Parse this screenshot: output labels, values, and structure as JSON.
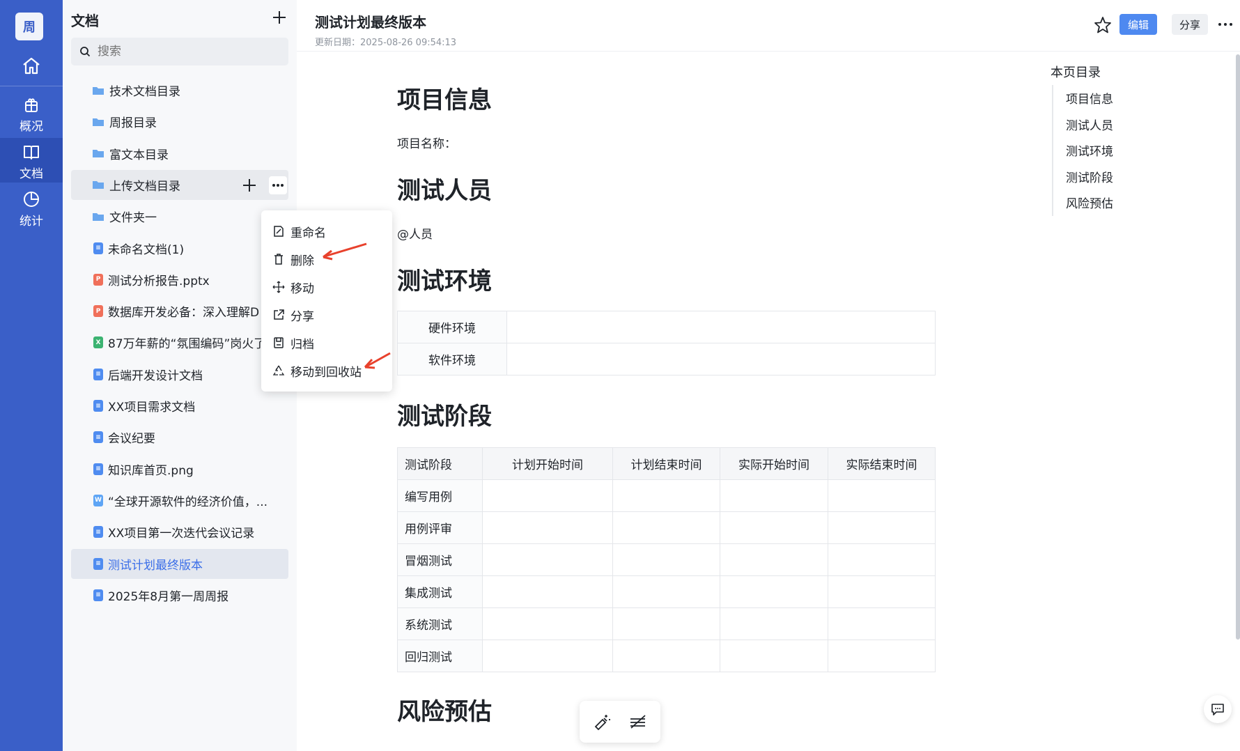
{
  "rail": {
    "avatar": "周",
    "items": [
      {
        "label": ""
      },
      {
        "label": "概况"
      },
      {
        "label": "文档"
      },
      {
        "label": "统计"
      }
    ]
  },
  "sidebar": {
    "title": "文档",
    "search_placeholder": "搜索",
    "items": [
      {
        "label": "技术文档目录",
        "type": "folder"
      },
      {
        "label": "周报目录",
        "type": "folder"
      },
      {
        "label": "富文本目录",
        "type": "folder"
      },
      {
        "label": "上传文档目录",
        "type": "folder"
      },
      {
        "label": "文件夹一",
        "type": "folder"
      },
      {
        "label": "未命名文档(1)",
        "type": "doc"
      },
      {
        "label": "测试分析报告.pptx",
        "type": "ppt"
      },
      {
        "label": "数据库开发必备：深入理解D",
        "type": "ppt"
      },
      {
        "label": "87万年薪的“氛围编码”岗火了",
        "type": "xls"
      },
      {
        "label": "后端开发设计文档",
        "type": "doc"
      },
      {
        "label": "XX项目需求文档",
        "type": "doc"
      },
      {
        "label": "会议纪要",
        "type": "doc"
      },
      {
        "label": "知识库首页.png",
        "type": "doc"
      },
      {
        "label": "“全球开源软件的经济价值，...",
        "type": "word"
      },
      {
        "label": "XX项目第一次迭代会议记录",
        "type": "doc"
      },
      {
        "label": "测试计划最终版本",
        "type": "doc"
      },
      {
        "label": "2025年8月第一周周报",
        "type": "doc"
      }
    ]
  },
  "context_menu": {
    "items": [
      "重命名",
      "删除",
      "移动",
      "分享",
      "归档",
      "移动到回收站"
    ]
  },
  "header": {
    "title": "测试计划最终版本",
    "date": "更新日期：2025-08-26 09:54:13",
    "edit_label": "编辑",
    "share_label": "分享"
  },
  "doc": {
    "h_project": "项目信息",
    "project_name": "项目名称：",
    "h_people": "测试人员",
    "people_mention": "@人员",
    "h_env": "测试环境",
    "env_rows": [
      "硬件环境",
      "软件环境"
    ],
    "h_stage": "测试阶段",
    "stage_headers": [
      "测试阶段",
      "计划开始时间",
      "计划结束时间",
      "实际开始时间",
      "实际结束时间"
    ],
    "stage_rows": [
      "编写用例",
      "用例评审",
      "冒烟测试",
      "集成测试",
      "系统测试",
      "回归测试"
    ],
    "h_risk": "风险预估"
  },
  "toc": {
    "title": "本页目录",
    "items": [
      "项目信息",
      "测试人员",
      "测试环境",
      "测试阶段",
      "风险预估"
    ]
  },
  "colors": {
    "rail": "#3a5fc8",
    "accent": "#4e89f0",
    "annotation_arrow": "#e8412c"
  }
}
